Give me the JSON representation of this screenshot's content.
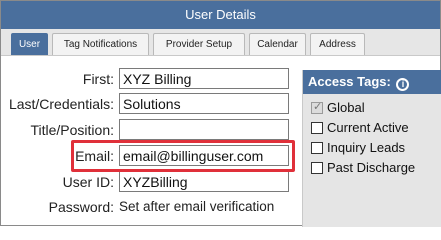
{
  "window": {
    "title": "User Details"
  },
  "tabs": [
    {
      "label": "User",
      "active": true
    },
    {
      "label": "Tag Notifications",
      "active": false
    },
    {
      "label": "Provider Setup",
      "active": false
    },
    {
      "label": "Calendar",
      "active": false
    },
    {
      "label": "Address",
      "active": false
    }
  ],
  "form": {
    "first": {
      "label": "First:",
      "value": "XYZ Billing"
    },
    "last": {
      "label": "Last/Credentials:",
      "value": "Solutions"
    },
    "title": {
      "label": "Title/Position:",
      "value": ""
    },
    "email": {
      "label": "Email:",
      "value": "email@billinguser.com"
    },
    "user_id": {
      "label": "User ID:",
      "value": "XYZBilling"
    },
    "password": {
      "label": "Password:",
      "value": "Set after email verification"
    }
  },
  "access_tags": {
    "header": "Access Tags:",
    "info_icon": "info-icon",
    "items": [
      {
        "label": "Global",
        "checked": true,
        "disabled": true
      },
      {
        "label": "Current Active",
        "checked": false,
        "disabled": false
      },
      {
        "label": "Inquiry Leads",
        "checked": false,
        "disabled": false
      },
      {
        "label": "Past Discharge",
        "checked": false,
        "disabled": false
      }
    ]
  },
  "colors": {
    "accent": "#4a6f9d",
    "highlight": "#e0303a",
    "panel_bg": "#e5e5e5"
  }
}
